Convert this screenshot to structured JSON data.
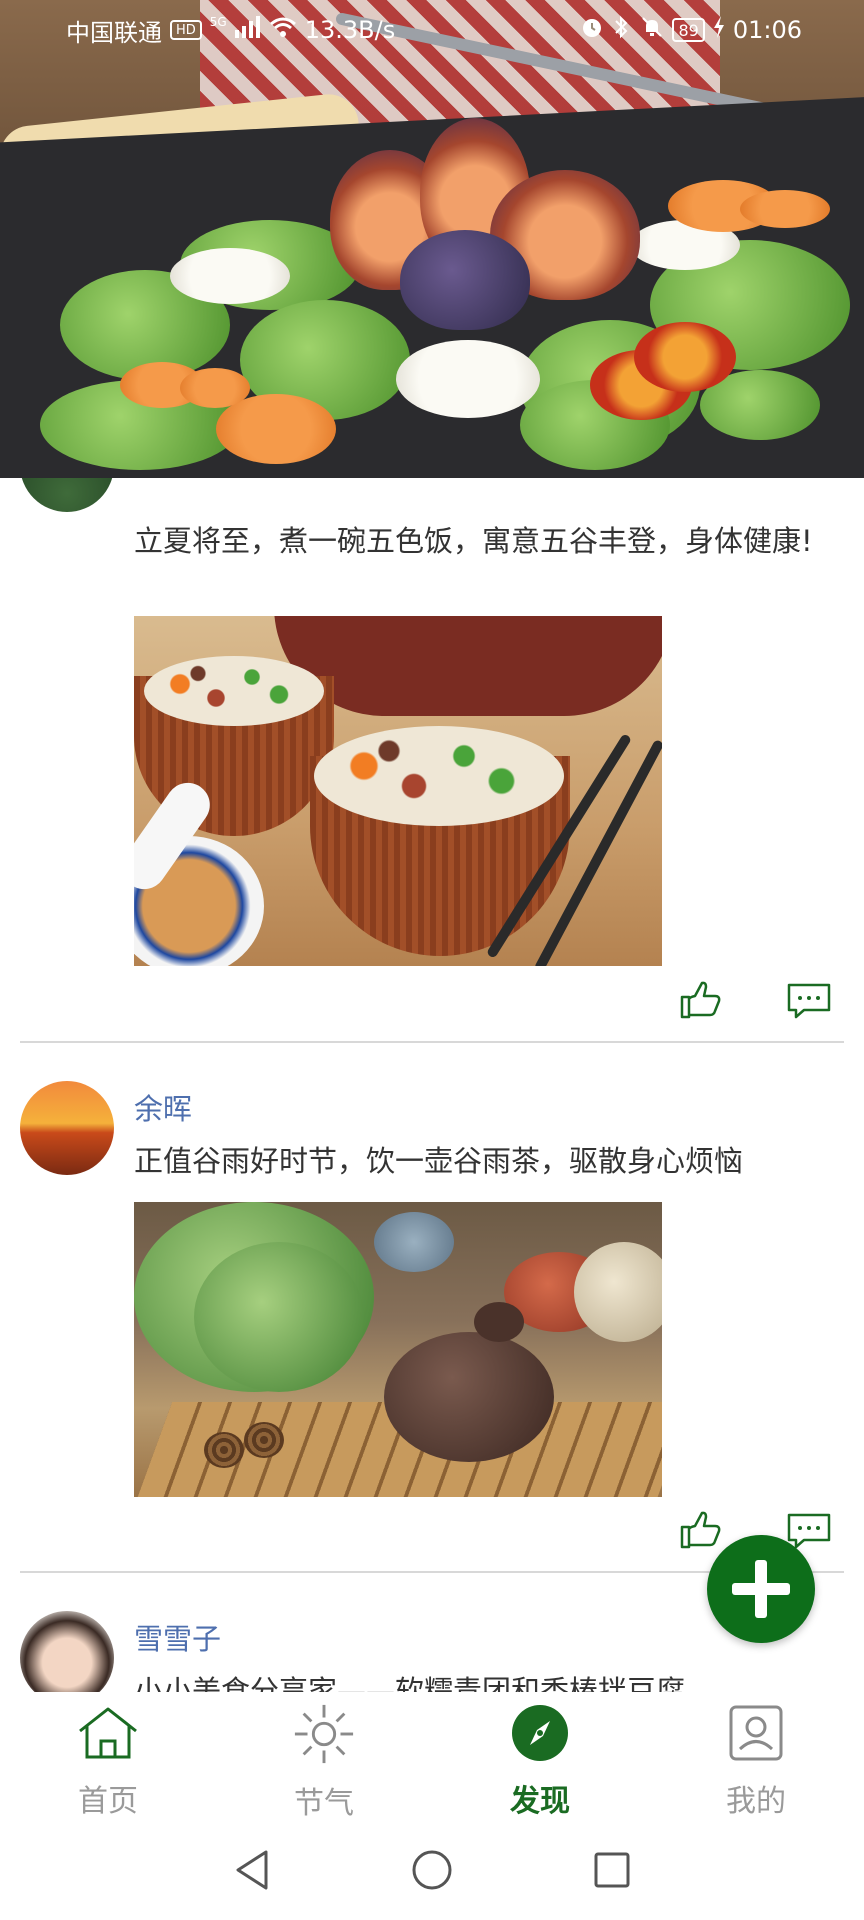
{
  "status_bar": {
    "carrier": "中国联通",
    "hd_badge": "HD",
    "network": "5G",
    "speed": "13.3B/s",
    "battery": "89",
    "time": "01:06",
    "icons": [
      "signal-icon",
      "wifi-icon",
      "alarm-icon",
      "bluetooth-icon",
      "mute-icon",
      "battery-icon",
      "charging-icon"
    ]
  },
  "hero": {
    "image": "salad-with-figs-photo"
  },
  "feed": {
    "posts": [
      {
        "text": "立夏将至，煮一碗五色饭，寓意五谷丰登，身体健康!",
        "image": "five-color-rice-bowls-photo"
      },
      {
        "name": "余晖",
        "text": "正值谷雨好时节，饮一壶谷雨茶，驱散身心烦恼",
        "image": "teapot-on-tray-photo"
      },
      {
        "name": "雪雪子",
        "text": "小小美食分享家——软糯青团和香椿拌豆腐"
      }
    ],
    "actions": {
      "like_icon": "thumbs-up-icon",
      "comment_icon": "comment-icon"
    }
  },
  "fab": {
    "icon": "plus-icon"
  },
  "tabs": [
    {
      "label": "首页",
      "icon": "home-icon",
      "active": false
    },
    {
      "label": "节气",
      "icon": "sun-icon",
      "active": false
    },
    {
      "label": "发现",
      "icon": "compass-icon",
      "active": true
    },
    {
      "label": "我的",
      "icon": "profile-icon",
      "active": false
    }
  ],
  "colors": {
    "accent": "#1a6b22",
    "fab": "#0d6e1a",
    "name": "#4e6fae",
    "tab_inactive": "#9a9a9a"
  }
}
